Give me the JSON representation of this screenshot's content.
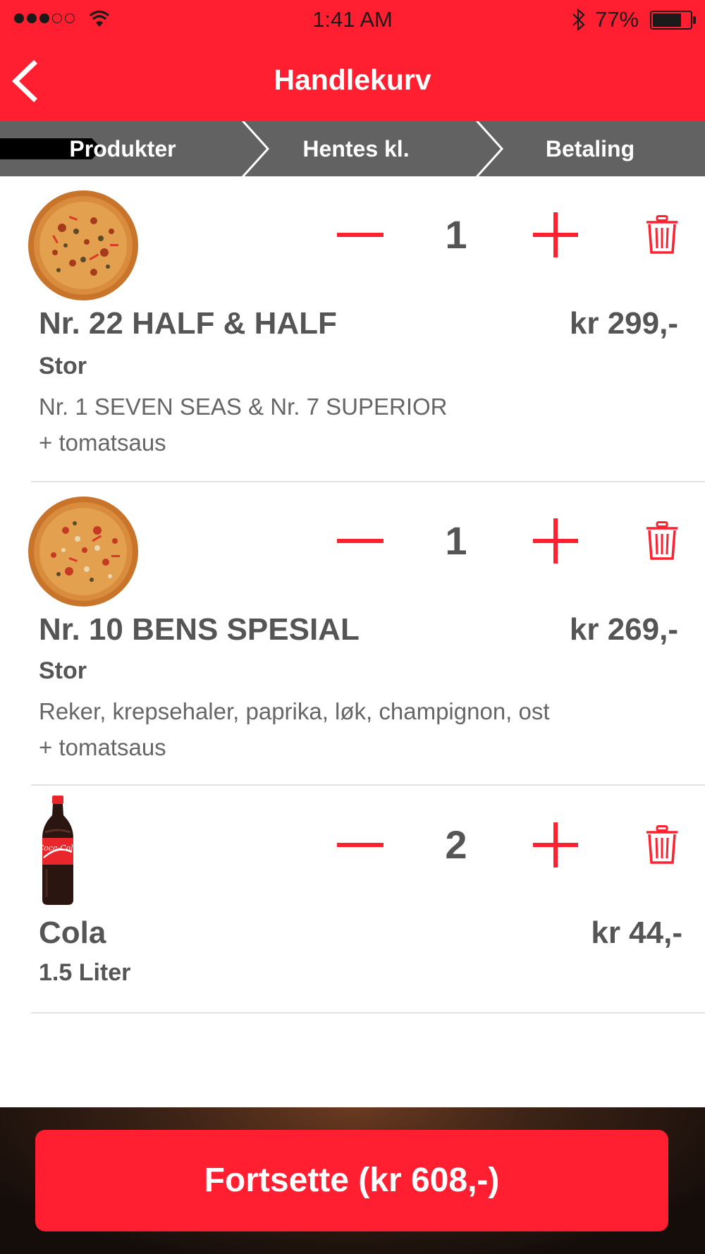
{
  "status_bar": {
    "time": "1:41 AM",
    "battery_percent": "77%",
    "battery_level": 0.77,
    "signal_bars_filled": 3,
    "signal_bars_total": 5
  },
  "header": {
    "title": "Handlekurv",
    "back_icon": "chevron-left-icon"
  },
  "steps": [
    {
      "label": "Produkter",
      "active": true
    },
    {
      "label": "Hentes kl.",
      "active": false
    },
    {
      "label": "Betaling",
      "active": false
    }
  ],
  "cart": {
    "items": [
      {
        "image": "pizza",
        "quantity": "1",
        "name": "Nr. 22 HALF & HALF",
        "price": "kr 299,-",
        "size": "Stor",
        "description": [
          "Nr. 1 SEVEN SEAS & Nr. 7 SUPERIOR",
          "+ tomatsaus"
        ]
      },
      {
        "image": "pizza",
        "quantity": "1",
        "name": "Nr. 10 BENS SPESIAL",
        "price": "kr 269,-",
        "size": "Stor",
        "description": [
          "Reker, krepsehaler, paprika, løk, champignon, ost",
          "+ tomatsaus"
        ]
      },
      {
        "image": "cola-bottle",
        "image_label": "Coca-Cola",
        "quantity": "2",
        "name": "Cola",
        "price": "kr 44,-",
        "size": "1.5 Liter",
        "description": []
      }
    ]
  },
  "footer": {
    "continue_label": "Fortsette (kr 608,-)"
  },
  "colors": {
    "accent": "#ff1f30",
    "step_active": "#000000",
    "step_inactive": "#626262",
    "text": "#555555"
  }
}
